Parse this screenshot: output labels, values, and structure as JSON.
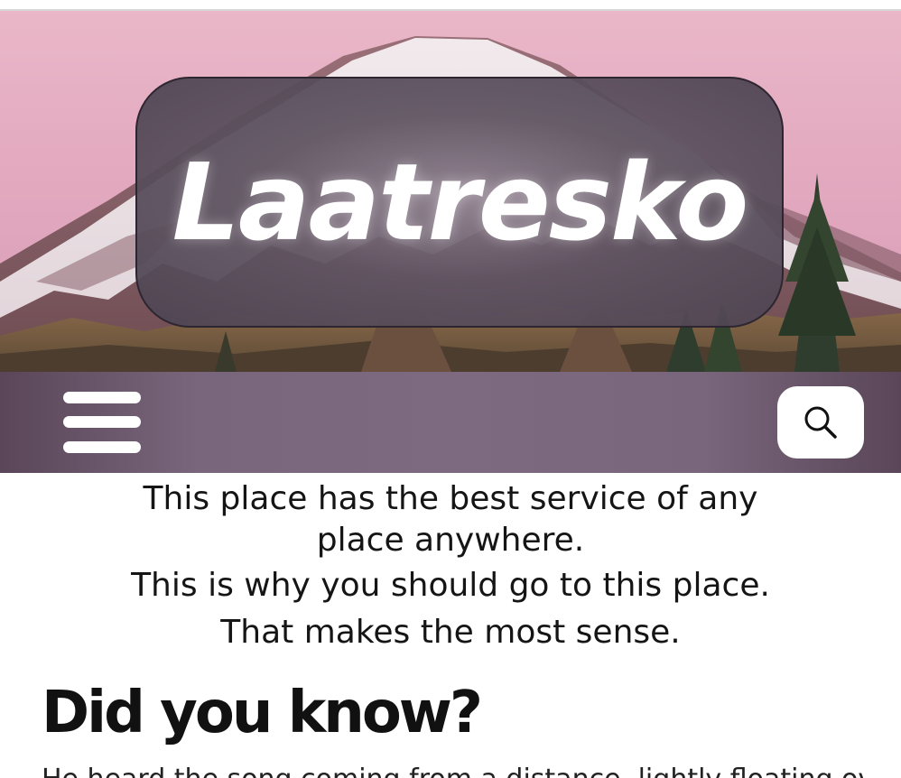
{
  "header": {
    "site_title": "Laatresko"
  },
  "nav": {
    "menu_icon": "hamburger-menu-icon",
    "search_icon": "search-icon"
  },
  "intro": {
    "line1": "This place has the best service of any place anywhere.",
    "line2": "This is why you should go to this place.",
    "line3": "That makes the most sense."
  },
  "section": {
    "heading": "Did you know?",
    "paragraph": "He heard the song coming from a distance, lightly floating over"
  },
  "colors": {
    "nav_bar": "#7e6a80",
    "title_card": "#605462",
    "sky": "#e3a9bf"
  }
}
